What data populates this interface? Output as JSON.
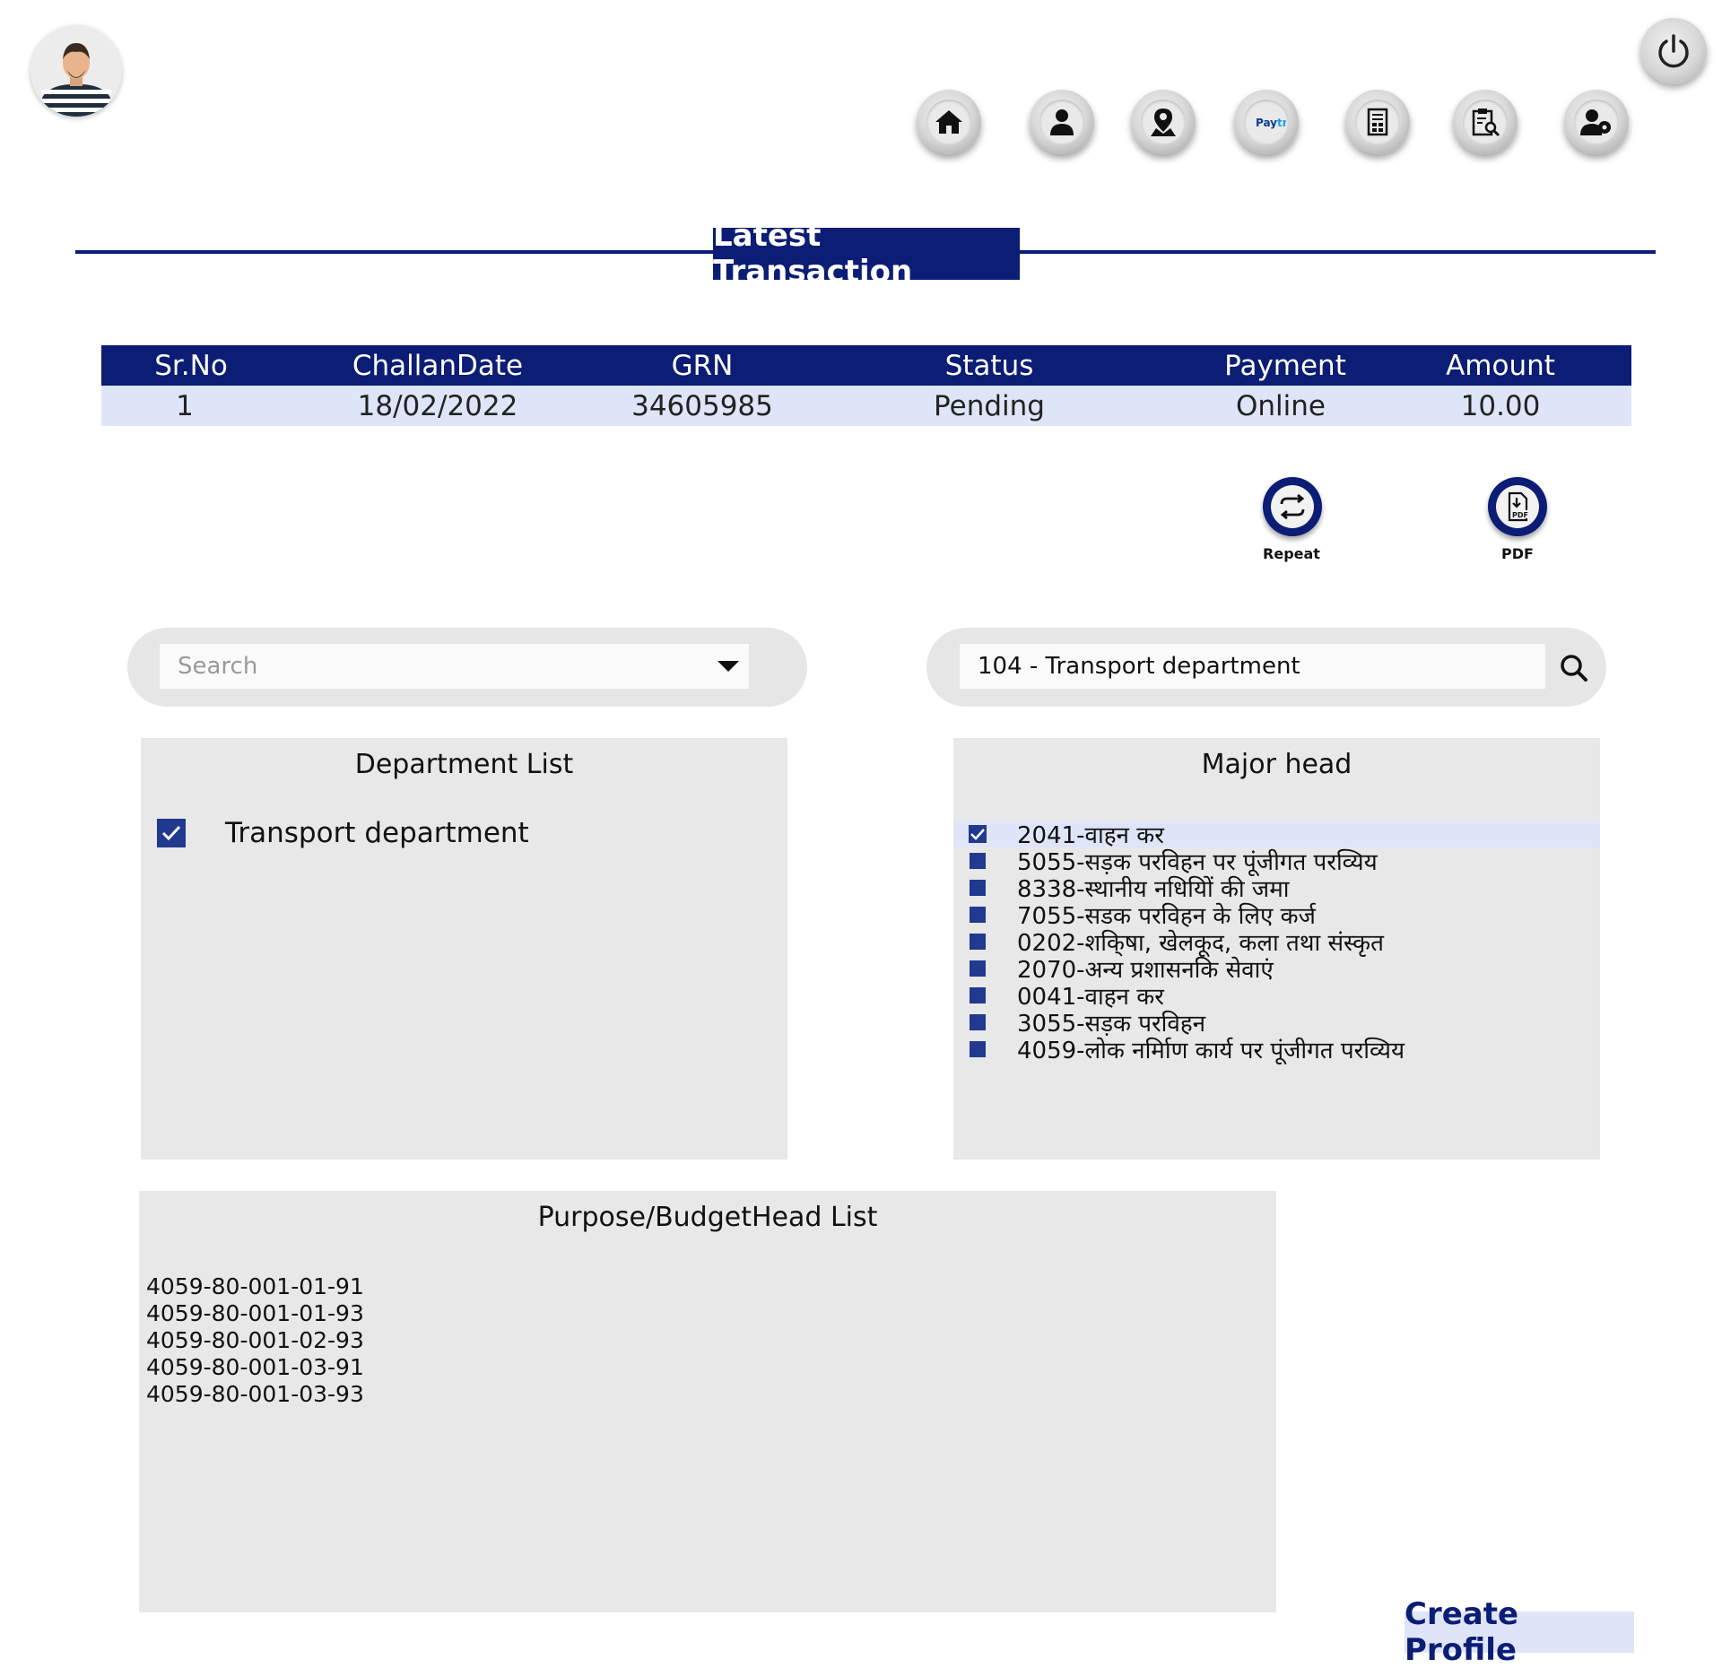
{
  "heading": {
    "title": "Latest Transaction"
  },
  "table": {
    "headers": [
      "Sr.No",
      "ChallanDate",
      "GRN",
      "Status",
      "Payment",
      "Amount"
    ],
    "rows": [
      [
        "1",
        "18/02/2022",
        "34605985",
        "Pending",
        "Online",
        "10.00"
      ]
    ]
  },
  "actions": {
    "repeat_label": "Repeat",
    "pdf_label": "PDF"
  },
  "nav": {
    "icons": [
      "home-icon",
      "user-icon",
      "map-pin-icon",
      "paytm-icon",
      "receipt-icon",
      "clipboard-search-icon",
      "user-settings-icon"
    ],
    "paytm_text": "Paytm"
  },
  "search": {
    "placeholder": "Search",
    "department_value": "104 - Transport department"
  },
  "department_list": {
    "title": "Department List",
    "items": [
      {
        "label": "Transport department",
        "checked": true
      }
    ]
  },
  "major_head": {
    "title": "Major head",
    "items": [
      {
        "label": "2041-वाहन कर",
        "checked": true
      },
      {
        "label": "5055-सड़क परविहन पर पूंजीगत परव्यिय",
        "checked": false
      },
      {
        "label": "8338-स्थानीय नधियिों की जमा",
        "checked": false
      },
      {
        "label": "7055-सडक परविहन के लिए कर्ज",
        "checked": false
      },
      {
        "label": "0202-शकि्षा, खेलकूद, कला तथा संस्कृत",
        "checked": false
      },
      {
        "label": "2070-अन्य प्रशासनकि सेवाएं",
        "checked": false
      },
      {
        "label": "0041-वाहन कर",
        "checked": false
      },
      {
        "label": "3055-सड़क परविहन",
        "checked": false
      },
      {
        "label": "4059-लोक नर्मिाण कार्य पर पूंजीगत परव्यिय",
        "checked": false
      }
    ]
  },
  "budget_head": {
    "title": "Purpose/BudgetHead List",
    "items": [
      "4059-80-001-01-91",
      "4059-80-001-01-93",
      "4059-80-001-02-93",
      "4059-80-001-03-91",
      "4059-80-001-03-93"
    ]
  },
  "footer": {
    "create_profile": "Create Profile"
  },
  "colors": {
    "navy": "#0b1d74",
    "row_tint": "#dfe5f8",
    "panel_bg": "#e8e8e8",
    "checkbox": "#21398f"
  }
}
